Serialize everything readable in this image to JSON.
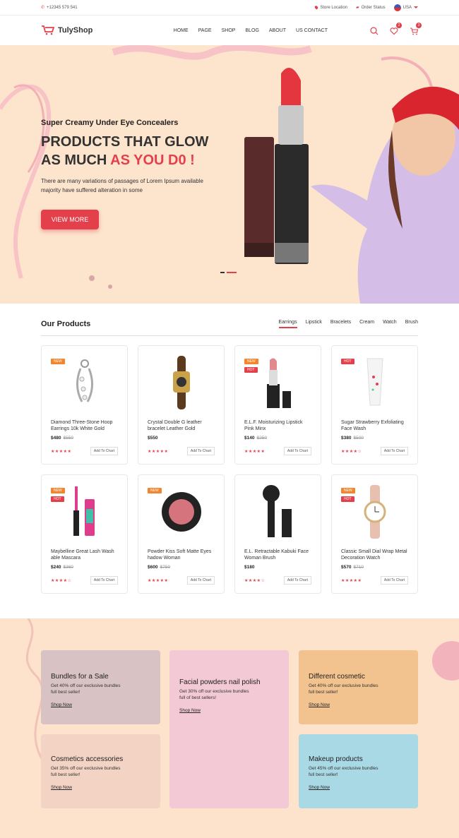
{
  "topbar": {
    "phone": "+12345 579 541",
    "store_location": "Store Location",
    "order_status": "Order Status",
    "currency": "USA"
  },
  "header": {
    "logo": "TulyShop",
    "nav": [
      "HOME",
      "PAGE",
      "SHOP",
      "BLOG",
      "ABOUT",
      "US CONTACT"
    ],
    "wishlist_count": "2",
    "cart_count": "3"
  },
  "hero": {
    "subtitle": "Super Creamy Under Eye Concealers",
    "title_line1": "PRODUCTS THAT GLOW",
    "title_line2_a": "AS MUCH ",
    "title_line2_b": "AS YOU D0 !",
    "description": "There are many variations of passages of Lorem Ipsum available majority have suffered alteration in some",
    "button": "VIEW MORE"
  },
  "products": {
    "title": "Our Products",
    "tabs": [
      "Earrings",
      "Lipstick",
      "Bracelets",
      "Cream",
      "Watch",
      "Brush"
    ],
    "add_label": "Add To Chart",
    "items": [
      {
        "name": "Diamond Three-Stone Hoop Earrings 10k White Gold",
        "price": "$480",
        "old": "$550",
        "badges": [
          "NEW"
        ],
        "stars": "★★★★★"
      },
      {
        "name": "Crystal Double G leather bracelet Leather Gold",
        "price": "$550",
        "old": "",
        "badges": [],
        "stars": "★★★★★"
      },
      {
        "name": "E.L.F. Moisturizing Lipstick Pink Minx",
        "price": "$140",
        "old": "$250",
        "badges": [
          "NEW",
          "HOT"
        ],
        "stars": "★★★★★"
      },
      {
        "name": "Sugar Strawberry Exfoliating Face Wash",
        "price": "$380",
        "old": "$500",
        "badges": [
          "HOT"
        ],
        "stars": "★★★★☆"
      },
      {
        "name": "Maybelline Great Lash Wash able Mascara",
        "price": "$240",
        "old": "$360",
        "badges": [
          "NEW",
          "HOT"
        ],
        "stars": "★★★★☆"
      },
      {
        "name": "Powder Kiss Soft Matte Eyes hadow Woman",
        "price": "$600",
        "old": "$750",
        "badges": [
          "NEW"
        ],
        "stars": "★★★★★"
      },
      {
        "name": "E.L. Retractable Kabuki Face Woman Brush",
        "price": "$180",
        "old": "",
        "badges": [],
        "stars": "★★★★☆"
      },
      {
        "name": "Classic Small Dial Wrap Metal Decoration Watch",
        "price": "$570",
        "old": "$710",
        "badges": [
          "NEW",
          "HOT"
        ],
        "stars": "★★★★★"
      }
    ]
  },
  "banners": [
    {
      "title": "Bundles for a Sale",
      "desc": "Get 40% off our exclusive bundles full best seller!",
      "link": "Shop Now",
      "color": "#d8c2c4"
    },
    {
      "title": "Facial powders nail polish",
      "desc": "Get 30% off our exclusive bundles full of best sellers!",
      "link": "Shop Now",
      "color": "#f3c9d6"
    },
    {
      "title": "Different cosmetic",
      "desc": "Get 40% off our exclusive bundles full best seller!",
      "link": "Shop Now",
      "color": "#f2c28f"
    },
    {
      "title": "Cosmetics accessories",
      "desc": "Get 35% off our exclusive bundles full best seller!",
      "link": "Shop Now",
      "color": "#f3d4c4"
    },
    {
      "title": "Makeup products",
      "desc": "Get 45% off our exclusive bundles full best seller!",
      "link": "Shop Now",
      "color": "#a9d9e4"
    }
  ]
}
